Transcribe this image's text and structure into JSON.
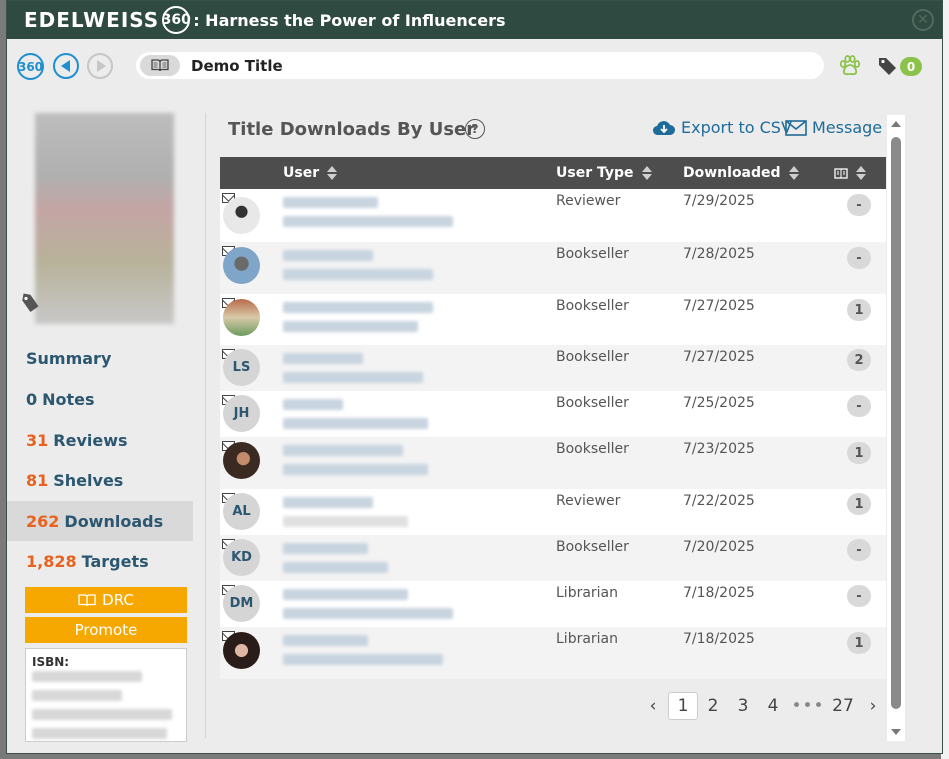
{
  "app": {
    "logo": "EDELWEISS",
    "logo_num": "360",
    "title": ": Harness the Power of Influencers"
  },
  "toolbar": {
    "home_label": "360",
    "title": "Demo Title",
    "tag_count": "0"
  },
  "sidebar": {
    "nav": [
      {
        "num": "",
        "label": "Summary"
      },
      {
        "num": "0",
        "label": "Notes"
      },
      {
        "num": "31",
        "label": "Reviews"
      },
      {
        "num": "81",
        "label": "Shelves"
      },
      {
        "num": "262",
        "label": "Downloads"
      },
      {
        "num": "1,828",
        "label": "Targets"
      }
    ],
    "drc_label": "DRC",
    "promote_label": "Promote",
    "isbn_label": "ISBN:"
  },
  "panel": {
    "title": "Title Downloads By User",
    "help": "?",
    "export_label": "Export to CSV",
    "message_label": "Message"
  },
  "table": {
    "headers": {
      "user": "User",
      "user_type": "User Type",
      "downloaded": "Downloaded"
    },
    "rows": [
      {
        "initials": "",
        "type": "Reviewer",
        "date": "7/29/2025",
        "count": "-"
      },
      {
        "initials": "",
        "type": "Bookseller",
        "date": "7/28/2025",
        "count": "-"
      },
      {
        "initials": "",
        "type": "Bookseller",
        "date": "7/27/2025",
        "count": "1"
      },
      {
        "initials": "LS",
        "type": "Bookseller",
        "date": "7/27/2025",
        "count": "2"
      },
      {
        "initials": "JH",
        "type": "Bookseller",
        "date": "7/25/2025",
        "count": "-"
      },
      {
        "initials": "",
        "type": "Bookseller",
        "date": "7/23/2025",
        "count": "1"
      },
      {
        "initials": "AL",
        "type": "Reviewer",
        "date": "7/22/2025",
        "count": "1"
      },
      {
        "initials": "KD",
        "type": "Bookseller",
        "date": "7/20/2025",
        "count": "-"
      },
      {
        "initials": "DM",
        "type": "Librarian",
        "date": "7/18/2025",
        "count": "-"
      },
      {
        "initials": "",
        "type": "Librarian",
        "date": "7/18/2025",
        "count": "1"
      }
    ]
  },
  "pager": {
    "prev": "‹",
    "pages": [
      "1",
      "2",
      "3",
      "4"
    ],
    "dots": "•••",
    "last": "27",
    "next": "›"
  },
  "colors": {
    "titlebar": "#2f4a40",
    "accent_blue": "#1f6b99",
    "accent_orange": "#e8621e",
    "button_orange": "#f7a800",
    "badge_green": "#8bc34a"
  }
}
